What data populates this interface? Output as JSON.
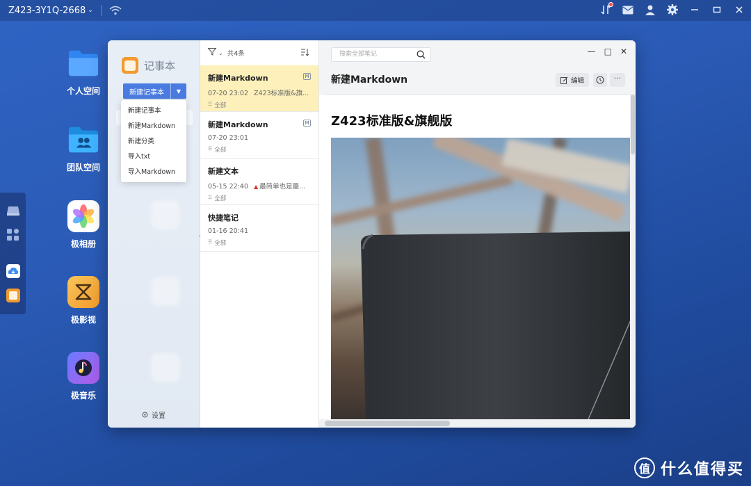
{
  "topbar": {
    "device_name": "Z423-3Y1Q-2668",
    "device_chevron": "⌄",
    "icons": [
      "wifi-icon",
      "transfer-icon",
      "mail-icon",
      "user-icon",
      "settings-icon"
    ],
    "window_controls": [
      "—",
      "□",
      "✕"
    ]
  },
  "desktop": {
    "apps": [
      {
        "label": "个人空间",
        "icon": "folder-icon"
      },
      {
        "label": "团队空间",
        "icon": "team-folder-icon"
      },
      {
        "label": "极相册",
        "icon": "photos-icon"
      },
      {
        "label": "极影视",
        "icon": "video-icon"
      },
      {
        "label": "极音乐",
        "icon": "music-icon"
      }
    ]
  },
  "notes_app": {
    "title": "记事本",
    "new_button": "新建记事本",
    "dropdown_items": [
      "新建记事本",
      "新建Markdown",
      "新建分类",
      "导入txt",
      "导入Markdown"
    ],
    "settings_label": "设置",
    "list_header": {
      "count": "共4条"
    },
    "notes": [
      {
        "title": "新建Markdown",
        "date": "07-20 23:02",
        "excerpt": "Z423标准版&旗...",
        "category": "全部",
        "type_badge": "M",
        "selected": true
      },
      {
        "title": "新建Markdown",
        "date": "07-20 23:01",
        "excerpt": "",
        "category": "全部",
        "type_badge": "M",
        "selected": false
      },
      {
        "title": "新建文本",
        "date": "05-15 22:40",
        "excerpt": "最简单也是最...",
        "category": "全部",
        "type_badge": "",
        "selected": false
      },
      {
        "title": "快捷笔记",
        "date": "01-16 20:41",
        "excerpt": "",
        "category": "全部",
        "type_badge": "",
        "selected": false
      }
    ],
    "editor": {
      "search_placeholder": "搜索全部笔记",
      "doc_title": "新建Markdown",
      "edit_label": "编辑",
      "more_label": "···",
      "heading": "Z423标准版&旗舰版"
    }
  },
  "watermark": {
    "glyph": "值",
    "text": "什么值得买"
  }
}
